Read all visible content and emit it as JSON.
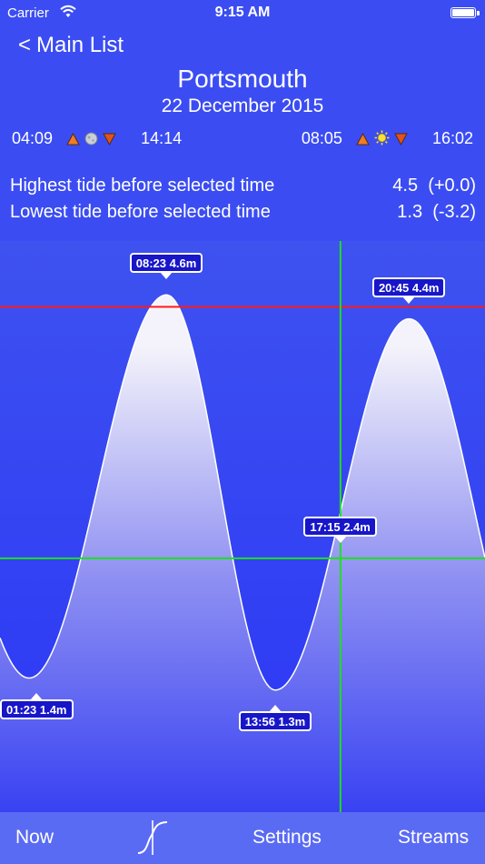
{
  "status": {
    "carrier": "Carrier",
    "time": "9:15 AM"
  },
  "nav": {
    "back": "Main List"
  },
  "location": "Portsmouth",
  "date": "22 December 2015",
  "astro": {
    "moonrise": "04:09",
    "moonset": "14:14",
    "sunrise": "08:05",
    "sunset": "16:02"
  },
  "info": [
    {
      "label": "Highest tide before selected time",
      "value": "4.5  (+0.0)"
    },
    {
      "label": "Lowest tide before selected time",
      "value": "1.3  (-3.2)"
    }
  ],
  "tides": [
    {
      "text": "01:23  1.4m",
      "time": "01:23",
      "height": 1.4
    },
    {
      "text": "08:23  4.6m",
      "time": "08:23",
      "height": 4.6
    },
    {
      "text": "13:56  1.3m",
      "time": "13:56",
      "height": 1.3
    },
    {
      "text": "20:45  4.4m",
      "time": "20:45",
      "height": 4.4
    }
  ],
  "selected": {
    "text": "17:15  2.4m",
    "time": "17:15",
    "height": 2.4
  },
  "highest_line_height": 4.5,
  "colors": {
    "background": "#3b4df2",
    "curve_fill_top": "#f4f3fb",
    "curve_fill_bottom": "#3842f2",
    "high_line": "#ff1a1a",
    "cursor": "#1ee01e",
    "label_bg": "#1716c9",
    "tab_bar": "#5a6bf3"
  },
  "tabs": {
    "now": "Now",
    "graph_icon": "tide-curve-icon",
    "settings": "Settings",
    "streams": "Streams"
  }
}
